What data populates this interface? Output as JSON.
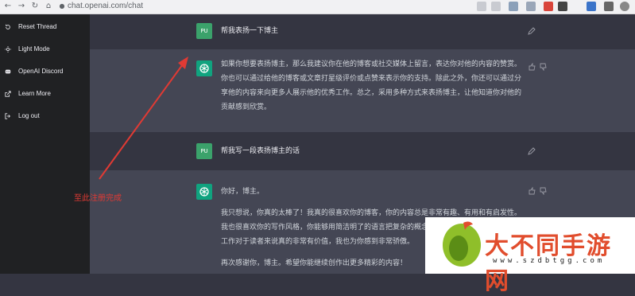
{
  "browser": {
    "url": "chat.openai.com/chat",
    "nav_icons": [
      "back-arrow-icon",
      "forward-arrow-icon",
      "reload-icon",
      "home-icon"
    ],
    "extension_icons": [
      "share-icon",
      "star-icon",
      "extensions-icon",
      "profile-icon"
    ]
  },
  "sidebar": {
    "items": [
      {
        "label": "Reset Thread",
        "icon": "reset-icon"
      },
      {
        "label": "Light Mode",
        "icon": "sun-icon"
      },
      {
        "label": "OpenAI Discord",
        "icon": "discord-icon"
      },
      {
        "label": "Learn More",
        "icon": "external-link-icon"
      },
      {
        "label": "Log out",
        "icon": "logout-icon"
      }
    ]
  },
  "conversation": [
    {
      "role": "user",
      "avatar": "PU",
      "text": "帮我表扬一下博主"
    },
    {
      "role": "assistant",
      "paragraphs": [
        "如果你想要表扬博主，那么我建议你在他的博客或社交媒体上留言，表达你对他的内容的赞赏。你也可以通过给他的博客或文章打星级评价或点赞来表示你的支持。除此之外，你还可以通过分享他的内容来向更多人展示他的优秀工作。总之，采用多种方式来表扬博主，让他知道你对他的贡献感到欣赏。"
      ]
    },
    {
      "role": "user",
      "avatar": "PU",
      "text": "帮我写一段表扬博主的话"
    },
    {
      "role": "assistant",
      "paragraphs": [
        "你好，博主。",
        "我只想说，你真的太棒了！我真的很喜欢你的博客，你的内容总是非常有趣、有用和有启发性。我也很喜欢你的写作风格，你能够用简洁明了的语言把复杂的概念表达得非常清晰。我认为你的工作对于读者来说真的非常有价值，我也为你感到非常骄傲。",
        "再次感谢你，博主。希望你能继续创作出更多精彩的内容！"
      ]
    }
  ],
  "annotation": {
    "label": "至此注册完成",
    "color": "#e03a34"
  },
  "watermark": {
    "title": "大不同手游网",
    "subtitle": "www.szdbtgg.com"
  },
  "colors": {
    "sidebar_bg": "#202123",
    "user_bg": "#343541",
    "bot_bg": "#444654",
    "accent": "#10a37f"
  }
}
